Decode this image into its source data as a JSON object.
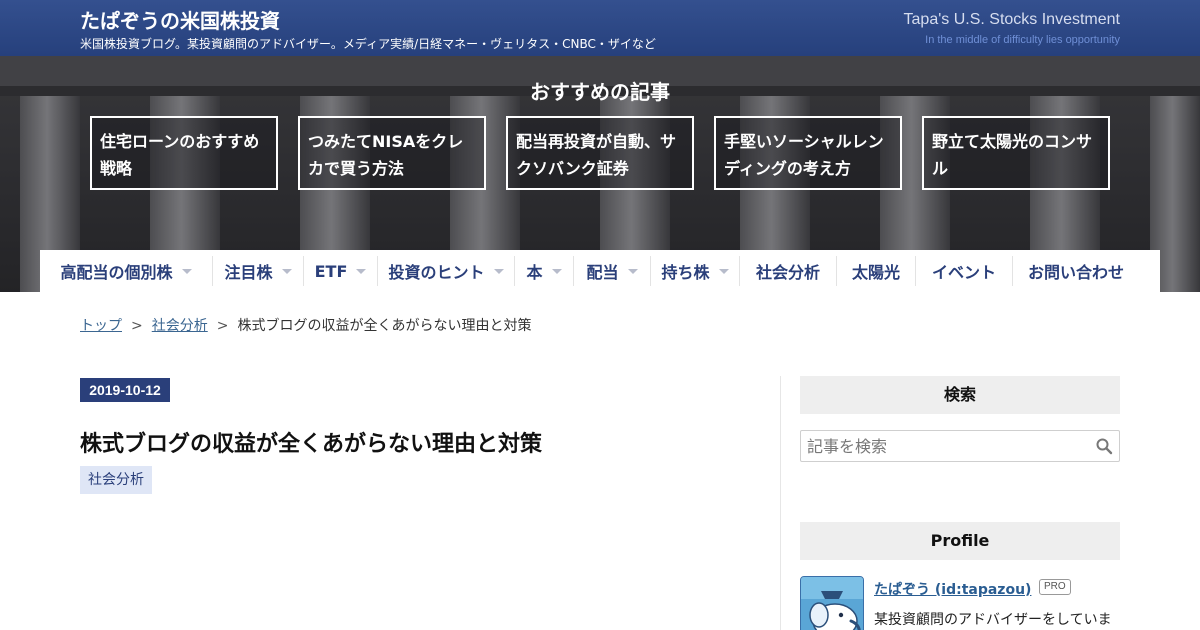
{
  "header": {
    "title": "たぱぞうの米国株投資",
    "description": "米国株投資ブログ。某投資顧問のアドバイザー。メディア実績/日経マネー・ヴェリタス・CNBC・ザイなど",
    "title_en": "Tapa's U.S. Stocks Investment",
    "motto": "In the middle of difficulty lies opportunity"
  },
  "hero": {
    "title": "おすすめの記事",
    "cards": [
      {
        "label": "住宅ローンのおすすめ戦略"
      },
      {
        "label": "つみたてNISAをクレカで買う方法"
      },
      {
        "label": "配当再投資が自動、サクソバンク証券"
      },
      {
        "label": "手堅いソーシャルレンディングの考え方"
      },
      {
        "label": "野立て太陽光のコンサル"
      }
    ]
  },
  "nav": {
    "items": [
      {
        "label": "高配当の個別株",
        "has_dropdown": true
      },
      {
        "label": "注目株",
        "has_dropdown": true
      },
      {
        "label": "ETF",
        "has_dropdown": true
      },
      {
        "label": "投資のヒント",
        "has_dropdown": true
      },
      {
        "label": "本",
        "has_dropdown": true
      },
      {
        "label": "配当",
        "has_dropdown": true
      },
      {
        "label": "持ち株",
        "has_dropdown": true
      },
      {
        "label": "社会分析",
        "has_dropdown": false
      },
      {
        "label": "太陽光",
        "has_dropdown": false
      },
      {
        "label": "イベント",
        "has_dropdown": false
      },
      {
        "label": "お問い合わせ",
        "has_dropdown": false
      }
    ]
  },
  "breadcrumb": {
    "home": "トップ",
    "category": "社会分析",
    "current": "株式ブログの収益が全くあがらない理由と対策",
    "separator": ">"
  },
  "article": {
    "date": "2019-10-12",
    "title": "株式ブログの収益が全くあがらない理由と対策",
    "category": "社会分析"
  },
  "sidebar": {
    "search_heading": "検索",
    "search_placeholder": "記事を検索",
    "profile_heading": "Profile",
    "profile_name": "たぱぞう (id:tapazou)",
    "pro_badge": "PRO",
    "profile_text": "某投資顧問のアドバイザーをしていま"
  },
  "colors": {
    "header_bg": "#2c4684",
    "nav_text": "#2a3f7a",
    "date_badge": "#2a3f7a",
    "tag_bg": "#dfe6f6",
    "link": "#3b6691"
  },
  "icons": [
    "search-icon",
    "chevron-down-icon",
    "avatar"
  ]
}
